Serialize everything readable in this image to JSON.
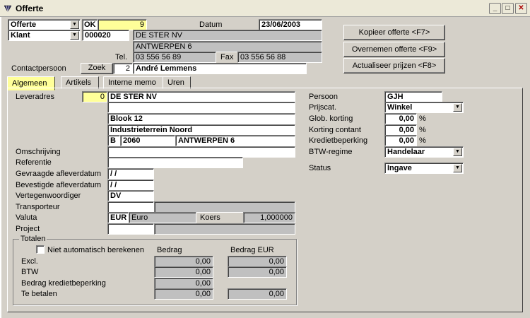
{
  "window": {
    "title": "Offerte",
    "minimize": "_",
    "maximize": "□",
    "close": "✕"
  },
  "header": {
    "doc_type": "Offerte",
    "ok_label": "OK",
    "doc_number": "9",
    "party_type": "Klant",
    "party_number": "000020",
    "datum_label": "Datum",
    "datum_value": "23/06/2003",
    "customer_name": "DE STER NV",
    "customer_city": "ANTWERPEN 6",
    "tel_label": "Tel.",
    "tel_value": "03 556 56 89",
    "fax_label": "Fax",
    "fax_value": "03 556 56 88",
    "contact_label": "Contactpersoon",
    "zoek_label": "Zoek",
    "contact_number": "2",
    "contact_name": "André Lemmens"
  },
  "actions": {
    "copy": "Kopieer offerte <F7>",
    "take_over": "Overnemen offerte <F9>",
    "update_prices": "Actualiseer prijzen <F8>"
  },
  "tabs": [
    "Algemeen",
    "Artikels",
    "Interne memo",
    "Uren"
  ],
  "general": {
    "leveradres_label": "Leveradres",
    "leveradres_number": "0",
    "address_line1": "DE STER NV",
    "address_line2": "",
    "address_line3": "Blook 12",
    "address_line4": "Industrieterrein Noord",
    "country": "B",
    "postcode": "2060",
    "city": "ANTWERPEN 6",
    "omschrijving_label": "Omschrijving",
    "referentie_label": "Referentie",
    "gevraagde_label": "Gevraagde afleverdatum",
    "gevraagde_value": " /  /",
    "bevestigde_label": "Bevestigde afleverdatum",
    "bevestigde_value": " /  /",
    "vertegen_label": "Vertegenwoordiger",
    "vertegen_value": "DV",
    "transporteur_label": "Transporteur",
    "valuta_label": "Valuta",
    "valuta_code": "EUR",
    "valuta_name": "Euro",
    "koers_label": "Koers",
    "koers_value": "1,000000",
    "project_label": "Project"
  },
  "right": {
    "persoon_label": "Persoon",
    "persoon_value": "GJH",
    "prijscat_label": "Prijscat.",
    "prijscat_value": "Winkel",
    "glob_label": "Glob. korting",
    "glob_value": "0,00",
    "contant_label": "Korting contant",
    "contant_value": "0,00",
    "krediet_label": "Kredietbeperking",
    "krediet_value": "0,00",
    "percent": "%",
    "btw_label": "BTW-regime",
    "btw_value": "Handelaar",
    "status_label": "Status",
    "status_value": "Ingave"
  },
  "totals": {
    "title": "Totalen",
    "checkbox_label": "Niet automatisch berekenen",
    "col_bedrag": "Bedrag",
    "col_bedrag_eur": "Bedrag EUR",
    "excl_label": "Excl.",
    "excl_bedrag": "0,00",
    "excl_eur": "0,00",
    "btw_label": "BTW",
    "btw_bedrag": "0,00",
    "btw_eur": "0,00",
    "krediet_label": "Bedrag kredietbeperking",
    "krediet_bedrag": "0,00",
    "tebetalen_label": "Te betalen",
    "tebetalen_bedrag": "0,00",
    "tebetalen_eur": "0,00"
  }
}
